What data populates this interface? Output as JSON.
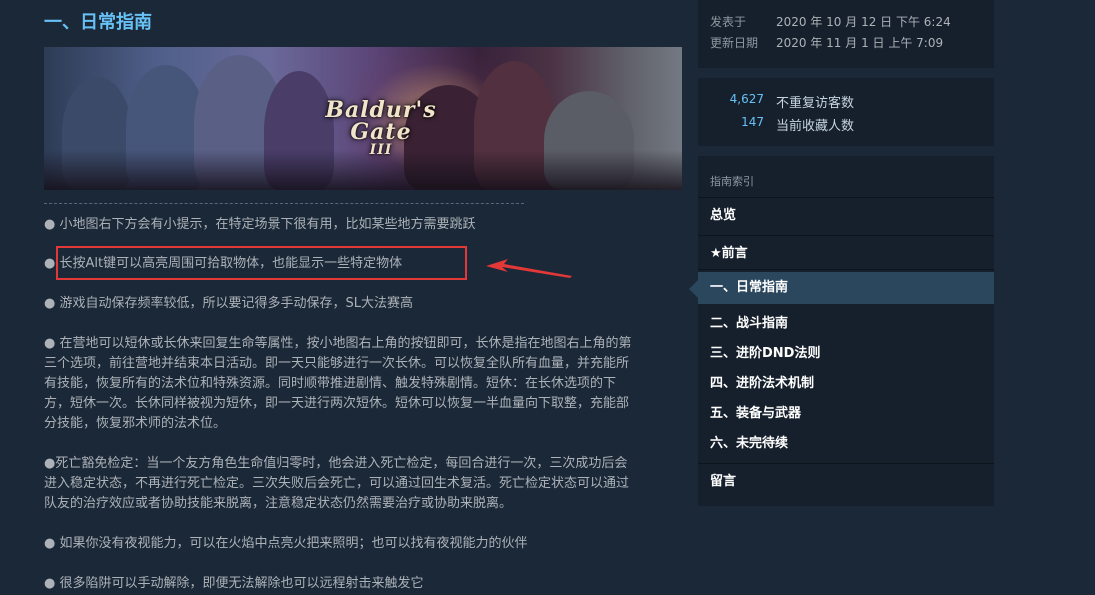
{
  "main": {
    "section_title": "一、日常指南",
    "banner_logo_line1": "Baldur's",
    "banner_logo_line2": "Gate",
    "banner_logo_numeral": "III",
    "paragraphs": [
      [
        "● 小地图右下方会有小提示，在特定场景下很有用，比如某些地方需要跳跃"
      ],
      [
        "● 长按Alt键可以高亮周围可拾取物体，也能显示一些特定物体"
      ],
      [
        "● 游戏自动保存频率较低，所以要记得多手动保存，SL大法赛高"
      ],
      [
        "● 在营地可以短休或长休来回复生命等属性，按小地图右上角的按钮即可，长休是指在地图右上角的第",
        "三个选项，前往营地并结束本日活动。即一天只能够进行一次长休。可以恢复全队所有血量，并充能所",
        "有技能，恢复所有的法术位和特殊资源。同时顺带推进剧情、触发特殊剧情。短休：在长休选项的下",
        "方，短休一次。长休同样被视为短休，即一天进行两次短休。短休可以恢复一半血量向下取整，充能部",
        "分技能，恢复邪术师的法术位。"
      ],
      [
        "●死亡豁免检定：当一个友方角色生命值归零时，他会进入死亡检定，每回合进行一次，三次成功后会",
        "进入稳定状态，不再进行死亡检定。三次失败后会死亡，可以通过回生术复活。死亡检定状态可以通过",
        "队友的治疗效应或者协助技能来脱离，注意稳定状态仍然需要治疗或协助来脱离。"
      ],
      [
        "● 如果你没有夜视能力，可以在火焰中点亮火把来照明；也可以找有夜视能力的伙伴"
      ],
      [
        "● 很多陷阱可以手动解除，即便无法解除也可以远程射击来触发它"
      ]
    ]
  },
  "sidebar": {
    "meta": {
      "posted_label": "发表于",
      "posted_value": "2020 年 10 月 12 日 下午 6:24",
      "updated_label": "更新日期",
      "updated_value": "2020 年 11 月 1 日 上午 7:09"
    },
    "stats": {
      "visitors_count": "4,627",
      "visitors_label": "不重复访客数",
      "favorites_count": "147",
      "favorites_label": "当前收藏人数"
    },
    "index": {
      "title": "指南索引",
      "items": [
        "总览",
        "★前言",
        "一、日常指南",
        "二、战斗指南",
        "三、进阶DND法则",
        "四、进阶法术机制",
        "五、装备与武器",
        "六、未完待续",
        "留言"
      ]
    }
  },
  "colors": {
    "background": "#1b2838",
    "accent_blue": "#67c1f5",
    "highlight_red": "#e23838",
    "active_item": "#2a475e"
  }
}
